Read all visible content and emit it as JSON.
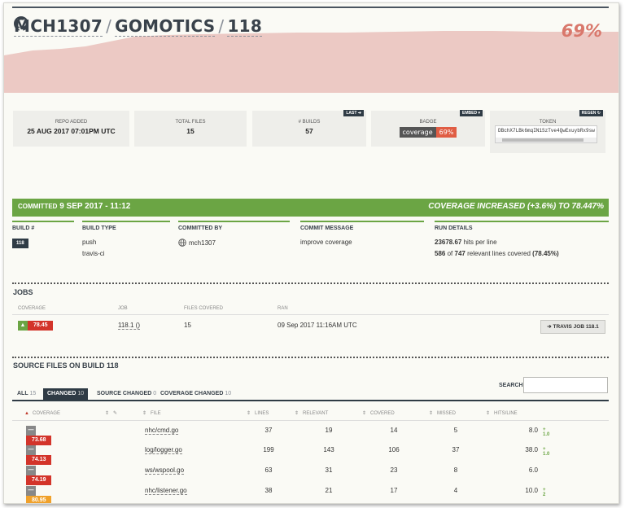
{
  "repo": {
    "owner": "MCH1307",
    "name": "GOMOTICS",
    "build": "118",
    "sep": "/"
  },
  "coverage_pct": "69%",
  "colors": {
    "green": "#6ba544",
    "red": "#d3342a",
    "orange": "#f0a12b",
    "dark": "#2f3b45",
    "pink_area": "#ecc9c4"
  },
  "stats": {
    "repo_added": {
      "label": "REPO ADDED",
      "value": "25 AUG 2017 07:01PM UTC"
    },
    "total_files": {
      "label": "TOTAL FILES",
      "value": "15"
    },
    "builds": {
      "label": "# BUILDS",
      "value": "57",
      "button": "LAST"
    },
    "badge": {
      "label": "BADGE",
      "button": "EMBED",
      "left": "coverage",
      "right": "69%"
    },
    "token": {
      "label": "TOKEN",
      "button": "REGEN",
      "value": "DBchX7LBk6mqIN1SzTve4QwExuybRx9sw"
    }
  },
  "commit_bar": {
    "committed_prefix": "COMMITTED",
    "date": "9 SEP 2017 - 11:12",
    "coverage_change": "COVERAGE INCREASED (+3.6%) TO 78.447%"
  },
  "details": {
    "build_header": "BUILD #",
    "build_number": "118",
    "build_type_header": "BUILD TYPE",
    "build_type_1": "push",
    "build_type_2": "travis-ci",
    "committed_by_header": "COMMITTED BY",
    "committed_by": "mch1307",
    "commit_message_header": "COMMIT MESSAGE",
    "commit_message": "improve coverage",
    "run_details_header": "RUN DETAILS",
    "hits_value": "23678.67",
    "hits_text": "hits per line",
    "lines_covered": "586",
    "lines_of": "of",
    "lines_total": "747",
    "lines_text": "relevant lines covered",
    "lines_pct": "(78.45%)"
  },
  "jobs": {
    "title": "JOBS",
    "headers": {
      "coverage": "COVERAGE",
      "job": "JOB",
      "files": "FILES COVERED",
      "ran": "RAN"
    },
    "row": {
      "coverage": "78.45",
      "job": "118.1 ()",
      "files": "15",
      "ran": "09 Sep 2017 11:16AM UTC",
      "button": "TRAVIS JOB 118.1"
    }
  },
  "source": {
    "title": "SOURCE FILES ON BUILD 118",
    "tabs": [
      {
        "label": "ALL",
        "count": "15"
      },
      {
        "label": "CHANGED",
        "count": "10"
      },
      {
        "label": "SOURCE CHANGED",
        "count": "0"
      },
      {
        "label": "COVERAGE CHANGED",
        "count": "10"
      }
    ],
    "search_label": "SEARCH:",
    "headers": {
      "coverage": "COVERAGE",
      "file": "FILE",
      "lines": "LINES",
      "relevant": "RELEVANT",
      "covered": "COVERED",
      "missed": "MISSED",
      "hits": "HITS/LINE"
    },
    "rows": [
      {
        "coverage": "73.68",
        "file": "nhc/cmd.go",
        "lines": "37",
        "relevant": "19",
        "covered": "14",
        "missed": "5",
        "hits": "8.0",
        "delta": "+ 1.0",
        "level": "red"
      },
      {
        "coverage": "74.13",
        "file": "log/logger.go",
        "lines": "199",
        "relevant": "143",
        "covered": "106",
        "missed": "37",
        "hits": "38.0",
        "delta": "+ 1.0",
        "level": "red"
      },
      {
        "coverage": "74.19",
        "file": "ws/wspool.go",
        "lines": "63",
        "relevant": "31",
        "covered": "23",
        "missed": "8",
        "hits": "6.0",
        "delta": "",
        "level": "red"
      },
      {
        "coverage": "80.95",
        "file": "nhc/listener.go",
        "lines": "38",
        "relevant": "21",
        "covered": "17",
        "missed": "4",
        "hits": "10.0",
        "delta": "+ 2",
        "level": "orange"
      }
    ]
  }
}
